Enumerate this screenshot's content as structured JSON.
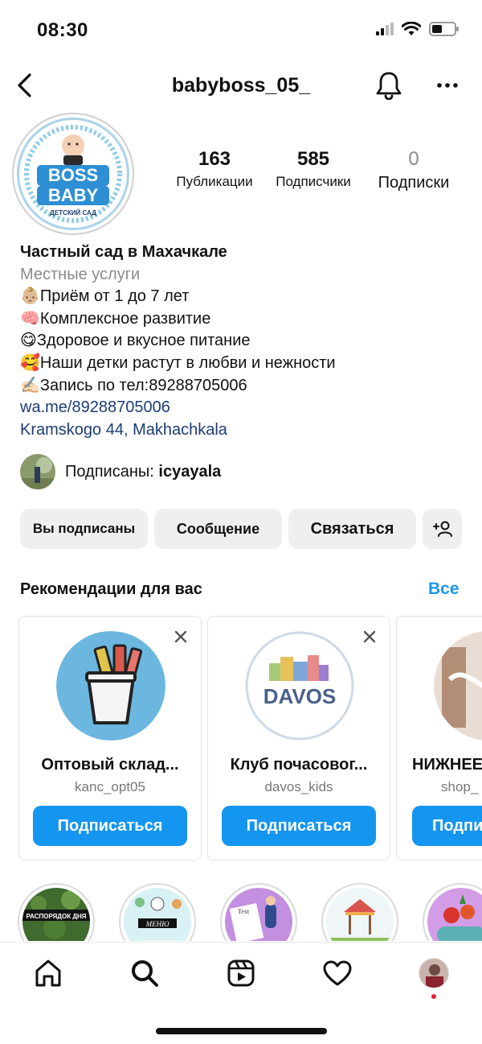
{
  "status_bar": {
    "time": "08:30"
  },
  "header": {
    "username": "babyboss_05_"
  },
  "profile": {
    "avatar_text_line1": "BOSS",
    "avatar_text_line2": "BABY",
    "avatar_text_line3": "ДЕТСКИЙ САД",
    "stats": [
      {
        "value": "163",
        "label": "Публикации"
      },
      {
        "value": "585",
        "label": "Подписчики"
      },
      {
        "value": "0",
        "label": "Подписки"
      }
    ],
    "bio": {
      "name": "Частный сад в Махачкале",
      "category": "Местные услуги",
      "lines": [
        "👶🏼Приём от 1 до 7 лет",
        "🧠Комплексное развитие",
        "😋Здоровое и вкусное питание",
        "🥰Наши детки растут в любви и нежности",
        "✍🏻Запись по тел:89288705006"
      ],
      "link": "wa.me/89288705006",
      "location": "Kramskogo 44, Makhachkala"
    },
    "followed_by": {
      "prefix": "Подписаны: ",
      "user": "icyayala"
    }
  },
  "actions": {
    "following": "Вы подписаны",
    "message": "Сообщение",
    "contact": "Связаться"
  },
  "recommendations": {
    "title": "Рекомендации для вас",
    "see_all": "Все",
    "cards": [
      {
        "name": "Оптовый склад...",
        "handle": "kanc_opt05",
        "follow": "Подписаться"
      },
      {
        "name": "Клуб почасовог...",
        "handle": "davos_kids",
        "follow": "Подписаться",
        "logo_text": "DAVOS"
      },
      {
        "name": "НИЖНЕЕ",
        "handle": "shop_",
        "follow": "Подпи"
      }
    ]
  },
  "highlights": [
    {
      "label": "РАСПОРЯДОК ДНЯ"
    },
    {
      "label": "МЕНЮ"
    },
    {
      "label": "Text"
    },
    {
      "label": ""
    },
    {
      "label": ""
    }
  ],
  "colors": {
    "accent_blue": "#1495ef",
    "link_blue": "#1c3d72",
    "see_all_blue": "#1c96ea",
    "button_gray": "#efefef"
  }
}
